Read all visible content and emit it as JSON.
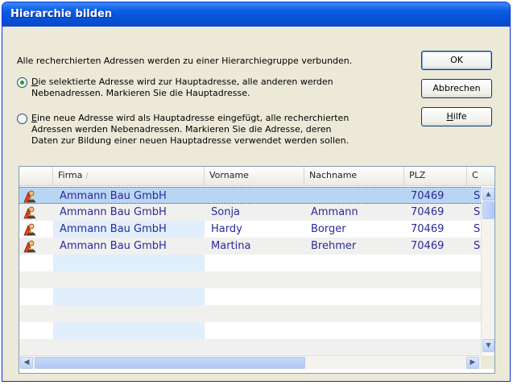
{
  "window": {
    "title": "Hierarchie bilden"
  },
  "message": "Alle recherchierten Adressen werden zu einer Hierarchiegruppe verbunden.",
  "options": [
    {
      "accel": "D",
      "rest_line1": "ie selektierte Adresse wird zur Hauptadresse, alle anderen werden",
      "line2": "Nebenadressen. Markieren Sie die Hauptadresse.",
      "line3": "",
      "checked": true
    },
    {
      "accel": "E",
      "rest_line1": "ine neue Adresse wird als Hauptadresse eingefügt, alle recherchierten",
      "line2": "Adressen werden Nebenadressen. Markieren Sie die Adresse, deren",
      "line3": "Daten zur Bildung einer neuen Hauptadresse verwendet werden sollen.",
      "checked": false
    }
  ],
  "buttons": {
    "ok": "OK",
    "cancel": "Abbrechen",
    "help": "Hilfe"
  },
  "table": {
    "columns": [
      "Firma",
      "Vorname",
      "Nachname",
      "PLZ",
      "C"
    ],
    "sort_indicator": "/",
    "rows": [
      {
        "firma": "Ammann Bau GmbH",
        "vorname": "",
        "nachname": "",
        "plz": "70469",
        "c": "S",
        "selected": true
      },
      {
        "firma": "Ammann Bau GmbH",
        "vorname": "Sonja",
        "nachname": "Ammann",
        "plz": "70469",
        "c": "S",
        "selected": false
      },
      {
        "firma": "Ammann Bau GmbH",
        "vorname": "Hardy",
        "nachname": "Borger",
        "plz": "70469",
        "c": "S",
        "selected": false
      },
      {
        "firma": "Ammann Bau GmbH",
        "vorname": "Martina",
        "nachname": "Brehmer",
        "plz": "70469",
        "c": "S",
        "selected": false
      }
    ],
    "row_icon": "address-person-icon",
    "empty_rows": 6
  },
  "colors": {
    "title_bar": "#0a5de6",
    "selection": "#b9d5f4",
    "cell_text": "#2a2a9a",
    "radio_dot": "#21a121"
  }
}
